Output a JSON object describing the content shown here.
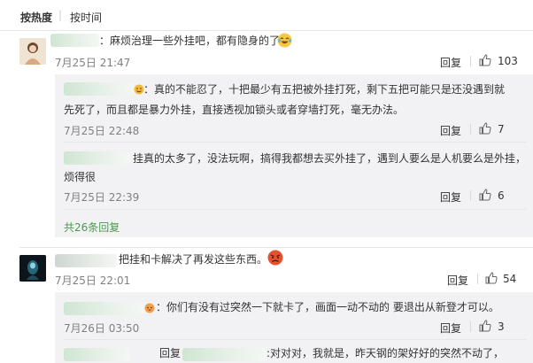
{
  "sort": {
    "hot": "按热度",
    "time": "按时间"
  },
  "comments": [
    {
      "text": "：麻烦治理一些外挂吧，都有隐身的了",
      "time": "7月25日 21:47",
      "reply_label": "回复",
      "likes": "103",
      "replies": [
        {
          "text_line1": "：真的不能忍了，十把最少有五把被外挂打死，剩下五把可能只是还没遇到就",
          "text_line2": "先死了，而且都是暴力外挂，直接透视加锁头或者穿墙打死，毫无办法。",
          "time": "7月25日 22:48",
          "reply_label": "回复",
          "likes": "7"
        },
        {
          "text_line1": "挂真的太多了，没法玩啊，搞得我都想去买外挂了，遇到人要么是人机要么是外挂，",
          "text_line2": "烦得很",
          "time": "7月25日 22:39",
          "reply_label": "回复",
          "likes": "6"
        }
      ],
      "more_replies": "共26条回复"
    },
    {
      "text": "把挂和卡解决了再发这些东西。",
      "time": "7月25日 22:01",
      "reply_label": "回复",
      "likes": "54",
      "replies": [
        {
          "text_line1": "：你们有没有过突然一下就卡了，画面一动不动的 要退出从新登才可以。",
          "time": "7月26日 03:50",
          "reply_label": "回复",
          "likes": "3"
        },
        {
          "prefix": "回复",
          "text_line1": ":对对对，我就是，昨天钢的架好好的突然不动了，"
        }
      ]
    }
  ],
  "icons": {
    "like": "thumbs-up-icon"
  }
}
